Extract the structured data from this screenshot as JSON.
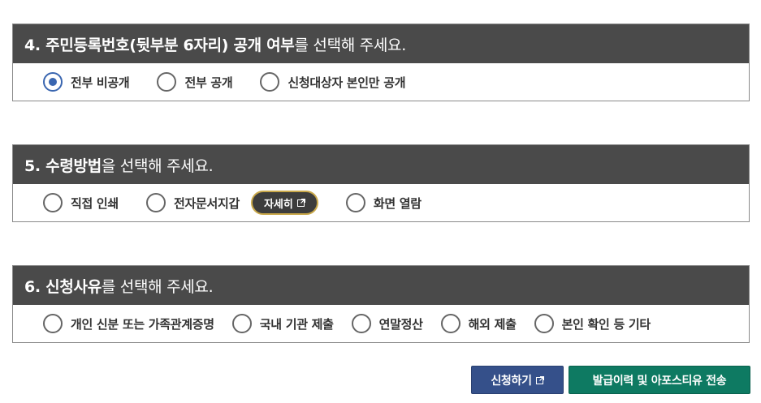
{
  "sections": [
    {
      "title_bold": "4. 주민등록번호(뒷부분 6자리) 공개 여부",
      "title_rest": "를 선택해 주세요.",
      "options": [
        "전부 비공개",
        "전부 공개",
        "신청대상자 본인만 공개"
      ],
      "selected": 0
    },
    {
      "title_bold": "5. 수령방법",
      "title_rest": "을 선택해 주세요.",
      "options": [
        "직접 인쇄",
        "전자문서지갑",
        "화면 열람"
      ],
      "detail_button": "자세히"
    },
    {
      "title_bold": "6. 신청사유",
      "title_rest": "를 선택해 주세요.",
      "options": [
        "개인 신분 또는 가족관계증명",
        "국내 기관 제출",
        "연말정산",
        "해외 제출",
        "본인 확인 등 기타"
      ]
    }
  ],
  "buttons": {
    "apply": "신청하기",
    "send": "발급이력 및 아포스티유 전송"
  },
  "colors": {
    "header_bg": "#4a4a4a",
    "radio_selected": "#3a66b0",
    "apply_btn": "#35508a",
    "send_btn": "#0e7a62",
    "detail_border": "#c9a84a"
  },
  "icons": {
    "external_link": "external-link-icon"
  }
}
